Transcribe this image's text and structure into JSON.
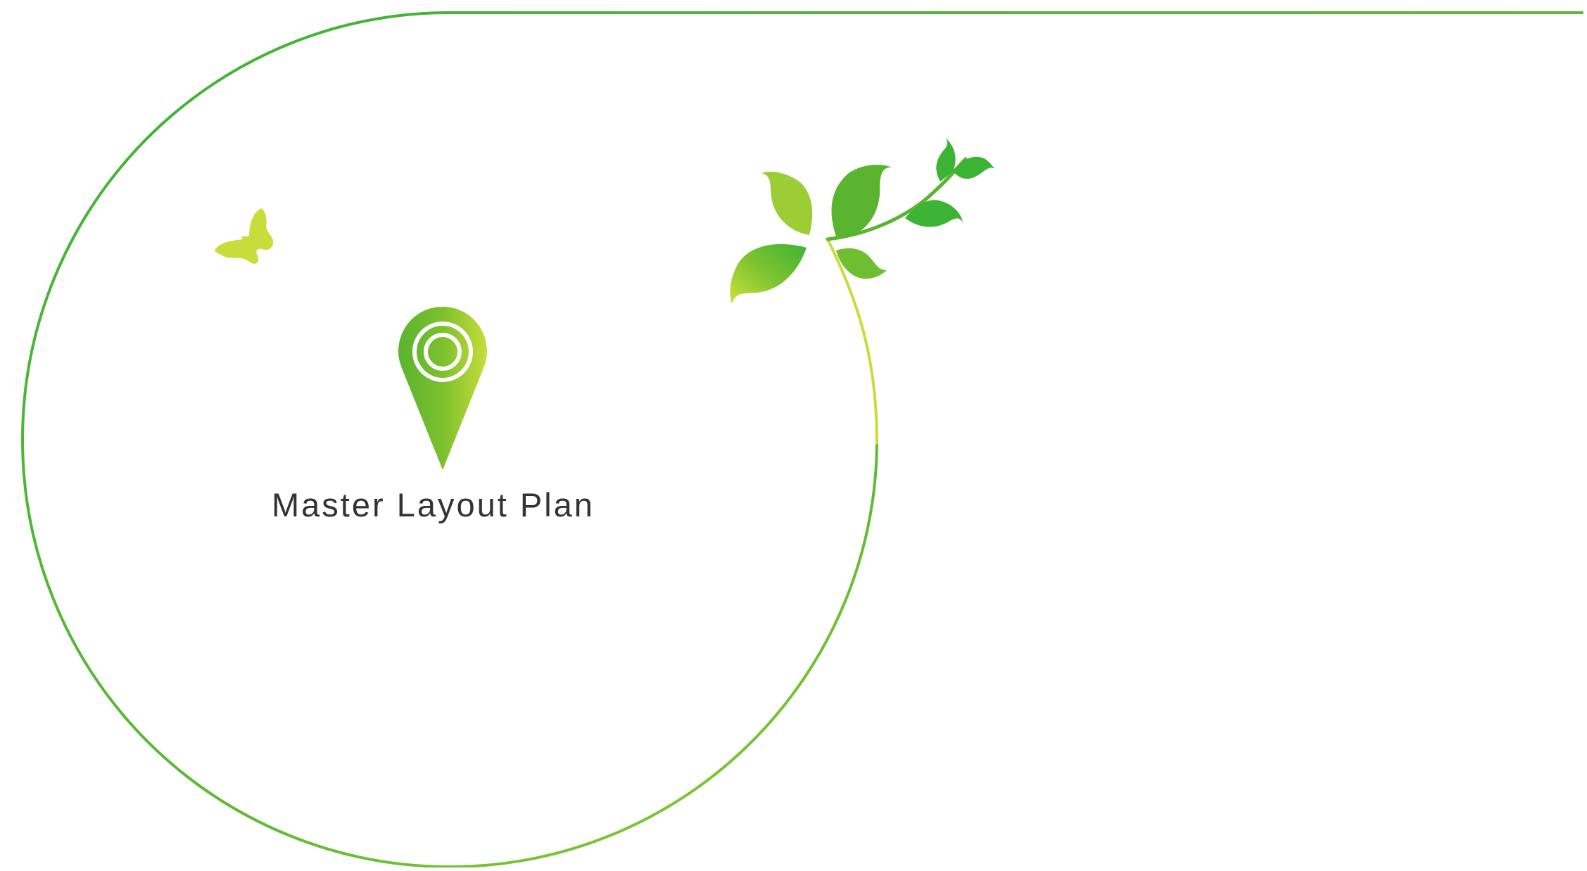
{
  "page": {
    "title": "Master Layout Plan"
  },
  "colors": {
    "green": "#3db336",
    "lime": "#c8dd3a",
    "text": "#333333"
  },
  "icons": {
    "pin": "location-pin-icon",
    "butterfly": "butterfly-icon",
    "leaves": "leafy-branch-icon"
  }
}
